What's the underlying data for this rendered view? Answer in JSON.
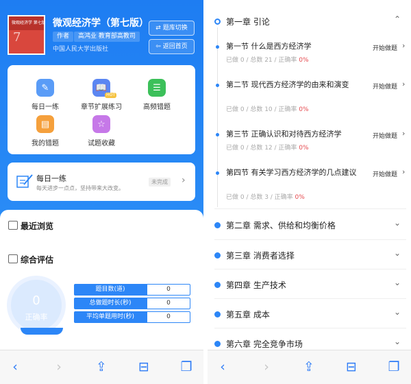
{
  "left": {
    "book": {
      "cover_text": "微观经济学 第七版",
      "cover_num": "7",
      "title": "微观经济学（第七版）",
      "author_tag": "作者",
      "author": "高鸿业 教育部高教司",
      "publisher": "中国人民大学出版社"
    },
    "header_buttons": [
      {
        "icon": "⇄",
        "label": "题库切换"
      },
      {
        "icon": "⇦",
        "label": "返回首页"
      }
    ],
    "grid": [
      {
        "label": "每日一练",
        "color": "#4a90f5",
        "glyph": "✎"
      },
      {
        "label": "章节扩展练习",
        "color": "#4a7cf0",
        "glyph": "📖",
        "badge": "HOT"
      },
      {
        "label": "高频错题",
        "color": "#3cc05a",
        "glyph": "☰"
      },
      {
        "label": "我的错题",
        "color": "#f5a03c",
        "glyph": "▤"
      },
      {
        "label": "试题收藏",
        "color": "#c678e8",
        "glyph": "☆"
      }
    ],
    "daily": {
      "title": "每日一练",
      "subtitle": "每天进步一点点，坚持带来大改变。",
      "badge": "未完成"
    },
    "sections": {
      "recent": "最近浏览",
      "evaluation": "综合评估"
    },
    "gauge": {
      "value": "0",
      "label": "正确率"
    },
    "stats": [
      {
        "label": "题目数(道)",
        "value": "0"
      },
      {
        "label": "总做题时长(秒)",
        "value": "0"
      },
      {
        "label": "平均单题用时(秒)",
        "value": "0"
      }
    ]
  },
  "toolbar": {
    "back": "‹",
    "forward": "›",
    "share": "⇪",
    "bookmarks": "⊟",
    "tabs": "❐"
  },
  "right": {
    "chapter1": {
      "title": "第一章 引论",
      "chevron": "⌃"
    },
    "sections": [
      {
        "name": "第一节 什么是西方经济学",
        "done": "已做 0 / 总数 21 / 正确率 ",
        "pct": "0%",
        "action": "开始做题"
      },
      {
        "name": "第二节 现代西方经济学的由来和演变",
        "done": "已做 0 / 总数 10 / 正确率 ",
        "pct": "0%",
        "action": "开始做题"
      },
      {
        "name": "第三节 正确认识和对待西方经济学",
        "done": "已做 0 / 总数 12 / 正确率 ",
        "pct": "0%",
        "action": "开始做题"
      },
      {
        "name": "第四节 有关学习西方经济学的几点建议",
        "done": "已做 0 / 总数 3 / 正确率 ",
        "pct": "0%",
        "action": "开始做题"
      }
    ],
    "chapters": [
      {
        "title": "第二章 需求、供给和均衡价格"
      },
      {
        "title": "第三章 消费者选择"
      },
      {
        "title": "第四章 生产技术"
      },
      {
        "title": "第五章 成本"
      },
      {
        "title": "第六章 完全竞争市场"
      }
    ],
    "collapsed_chevron": "⌄",
    "section_chevron": "›"
  },
  "colors": {
    "primary": "#2c86f7",
    "percent_red": "#e5484d"
  }
}
